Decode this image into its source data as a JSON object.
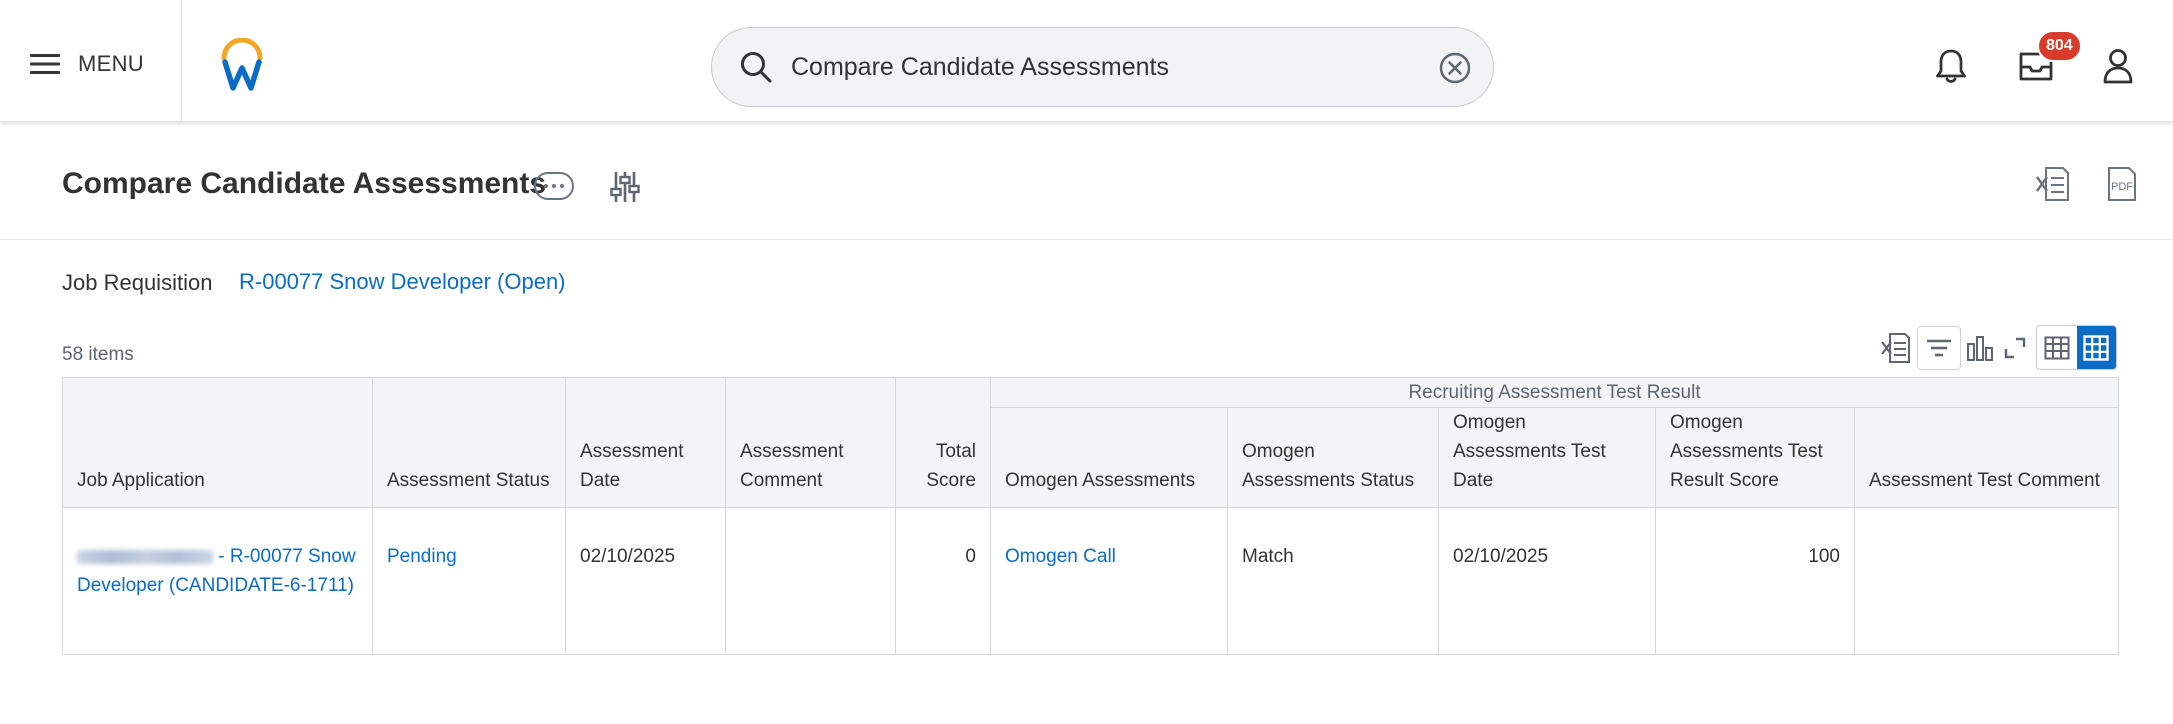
{
  "topbar": {
    "menu_label": "MENU",
    "search_value": "Compare Candidate Assessments",
    "inbox_badge": "804"
  },
  "page": {
    "title": "Compare Candidate Assessments",
    "job_requisition_label": "Job Requisition",
    "job_requisition_value": "R-00077 Snow Developer (Open)",
    "items_count": "58 items",
    "export_pdf_label": "PDF"
  },
  "table": {
    "group_header": "Recruiting Assessment Test Result",
    "headers": {
      "job_application": "Job Application",
      "assessment_status": "Assessment Status",
      "assessment_date": "Assessment Date",
      "assessment_comment": "Assessment Comment",
      "total_score": "Total Score",
      "omogen_assessments": "Omogen Assessments",
      "omogen_assessments_status": "Omogen Assessments Status",
      "omogen_assessments_test_date": "Omogen Assessments Test Date",
      "omogen_assessments_test_result_score": "Omogen Assessments Test Result Score",
      "assessment_test_comment": "Assessment Test Comment"
    },
    "rows": [
      {
        "job_application": "- R-00077 Snow Developer (CANDIDATE-6-1711)",
        "assessment_status": "Pending",
        "assessment_date": "02/10/2025",
        "assessment_comment": "",
        "total_score": "0",
        "omogen_assessments": "Omogen Call",
        "omogen_assessments_status": "Match",
        "omogen_assessments_test_date": "02/10/2025",
        "omogen_assessments_test_result_score": "100",
        "assessment_test_comment": ""
      }
    ]
  },
  "colors": {
    "link": "#0b6cc7",
    "badge": "#d93b2b",
    "header_bg": "#f3f4f5",
    "logo_orange": "#f5a623",
    "logo_blue": "#0b6cc7"
  },
  "icons": [
    "menu-icon",
    "workday-logo",
    "search-icon",
    "clear-search-icon",
    "notifications-bell-icon",
    "inbox-icon",
    "profile-icon",
    "related-actions-icon",
    "tune-icon",
    "export-excel-icon",
    "export-pdf-icon",
    "filter-icon",
    "chart-icon",
    "fullscreen-icon",
    "table-view-icon",
    "grid-view-icon"
  ]
}
